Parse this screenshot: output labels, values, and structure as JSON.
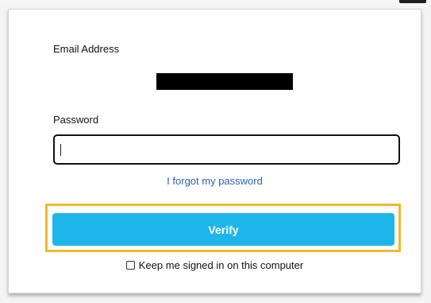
{
  "login": {
    "email_label": "Email Address",
    "password_label": "Password",
    "password_value": "",
    "forgot_link": "I forgot my password",
    "verify_button": "Verify",
    "keep_signed_in_label": "Keep me signed in on this computer",
    "keep_signed_in_checked": false
  },
  "colors": {
    "verify_button": "#1eb6ea",
    "highlight": "#f2b82a",
    "link": "#2c63b4"
  }
}
